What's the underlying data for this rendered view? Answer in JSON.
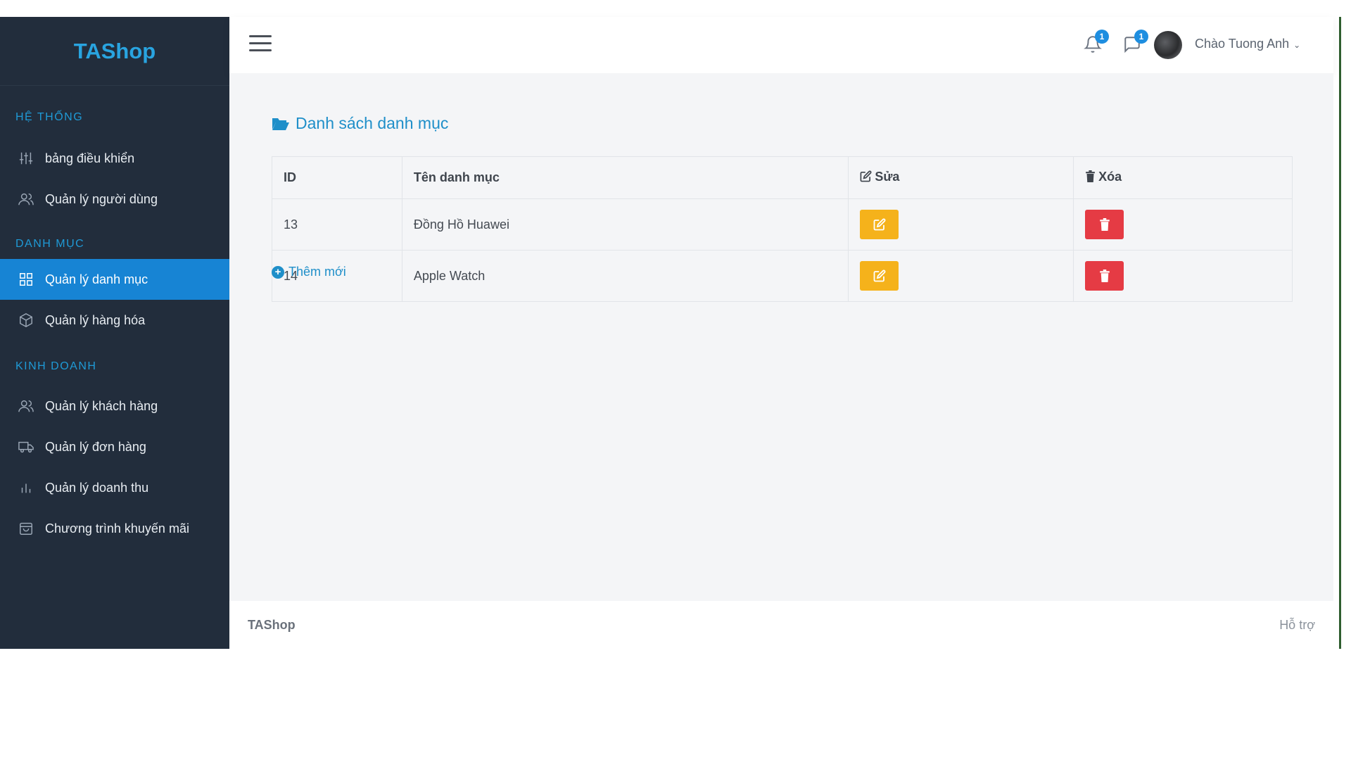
{
  "brand": "TAShop",
  "sidebar": {
    "sections": [
      {
        "title": "HỆ THỐNG",
        "items": [
          {
            "label": "bảng điều khiển",
            "icon": "sliders-icon"
          },
          {
            "label": "Quản lý người dùng",
            "icon": "users-icon"
          }
        ]
      },
      {
        "title": "DANH MỤC",
        "items": [
          {
            "label": "Quản lý danh mục",
            "icon": "grid-icon",
            "active": true
          },
          {
            "label": "Quản lý hàng hóa",
            "icon": "box-icon"
          }
        ]
      },
      {
        "title": "KINH DOANH",
        "items": [
          {
            "label": "Quản lý khách hàng",
            "icon": "users-icon"
          },
          {
            "label": "Quản lý đơn hàng",
            "icon": "truck-icon"
          },
          {
            "label": "Quản lý doanh thu",
            "icon": "bar-chart-icon"
          },
          {
            "label": "Chương trình khuyến mãi",
            "icon": "shopping-bag-icon"
          }
        ]
      }
    ]
  },
  "topbar": {
    "notifications_count": "1",
    "messages_count": "1",
    "user_greeting": "Chào Tuong Anh"
  },
  "main": {
    "title": "Danh sách danh mục",
    "columns": {
      "id": "ID",
      "name": "Tên danh mục",
      "edit": "Sửa",
      "delete": "Xóa"
    },
    "rows": [
      {
        "id": "13",
        "name": "Đồng Hồ Huawei"
      },
      {
        "id": "14",
        "name": "Apple Watch"
      }
    ],
    "add_new": "Thêm mới"
  },
  "footer": {
    "brand": "TAShop",
    "help": "Hỗ trợ"
  },
  "colors": {
    "sidebar_bg": "#222d3c",
    "accent": "#1784d4",
    "edit_button": "#f5b21b",
    "delete_button": "#e53b44"
  }
}
